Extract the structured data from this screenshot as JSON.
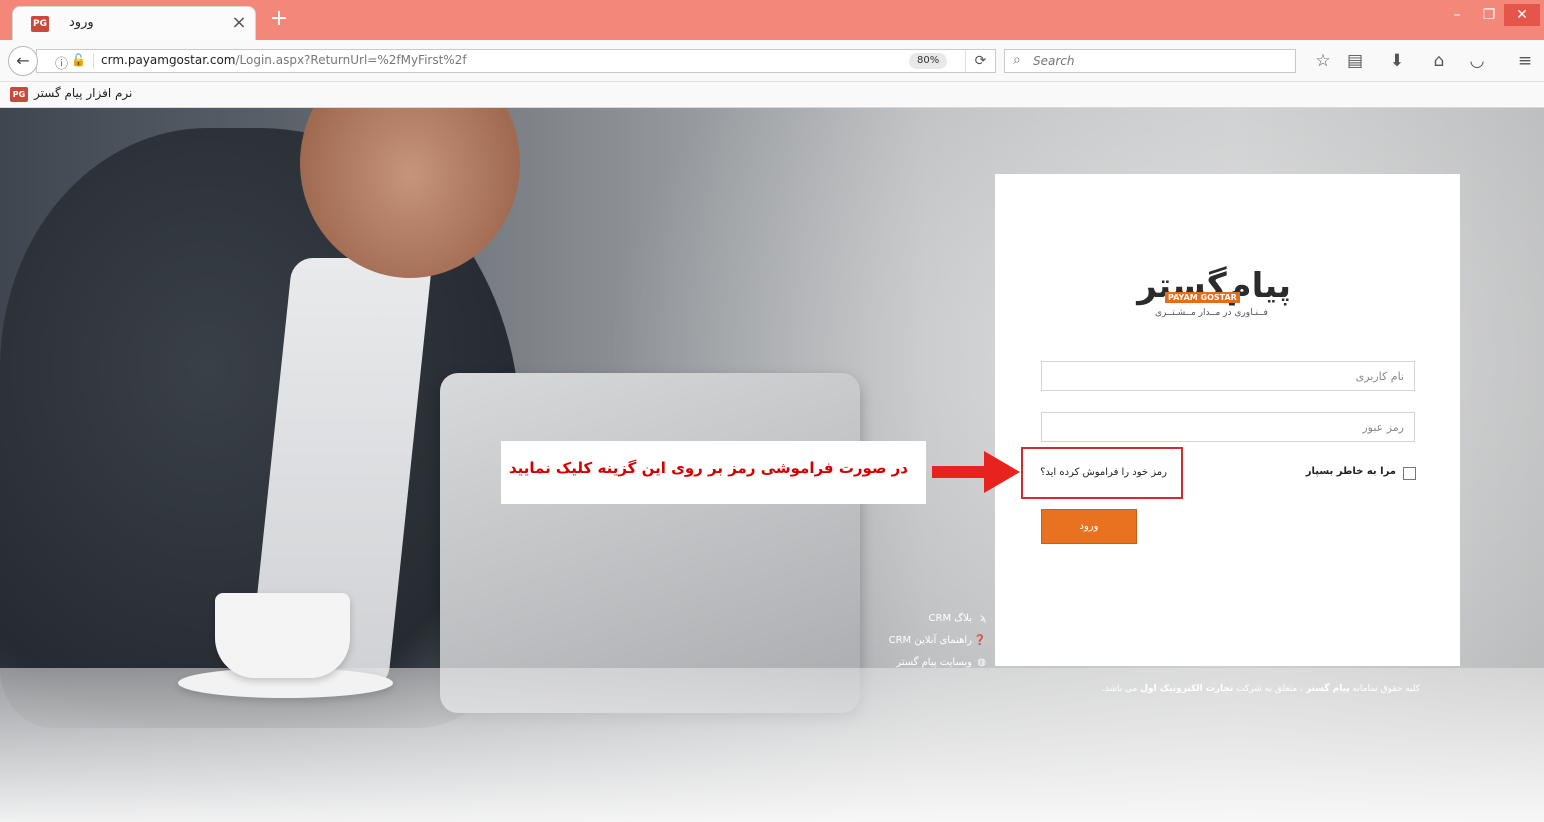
{
  "browser": {
    "tab_title": "ورود",
    "tab_favicon": "PG",
    "new_tab_symbol": "+",
    "tab_close_symbol": "×",
    "url_domain": "crm.payamgostar.com",
    "url_path": "/Login.aspx?ReturnUrl=%2fMyFirst%2f",
    "zoom": "80%",
    "search_placeholder": "Search",
    "window_controls": {
      "minimize": "–",
      "maximize": "❐",
      "close": "✕"
    },
    "icons": [
      "info-icon",
      "insecure-lock-icon",
      "reload-icon",
      "search-icon",
      "star-icon",
      "reading-list-icon",
      "download-icon",
      "home-icon",
      "pocket-icon",
      "menu-icon"
    ]
  },
  "bookmarks": [
    {
      "favicon": "PG",
      "label": "نرم افزار پیام گستر"
    }
  ],
  "login": {
    "logo_fa": "پیام‌گستر",
    "logo_en": "PAYAM GOSTAR",
    "logo_tagline": "فــنـاوری در مــدار مــشـتــری",
    "username_placeholder": "نام کاربری",
    "password_placeholder": "رمز عبور",
    "remember_label": "مرا به خاطر بسپار",
    "forgot_label": "رمز خود را فراموش کرده اید؟",
    "submit_label": "ورود"
  },
  "annotation": {
    "text": "در صورت فراموشی رمز بر روی این گزینه کلیک نمایید",
    "color": "#d40000"
  },
  "side_links": [
    {
      "icon": "rss-icon",
      "label": "بلاگ CRM"
    },
    {
      "icon": "help-icon",
      "label": "راهنمای آنلاین CRM"
    },
    {
      "icon": "globe-icon",
      "label": "وبسایت پیام گستر"
    }
  ],
  "copyright": {
    "prefix": "کلیه حقوق سامانه",
    "brand": "پیام گستر",
    "middle": "، متعلق به شرکت",
    "company": "تجارت الکترونیک اول",
    "suffix": "می باشد."
  },
  "colors": {
    "titlebar": "#f3877a",
    "accent_orange": "#e8721f",
    "highlight_red": "#d52a2a"
  }
}
